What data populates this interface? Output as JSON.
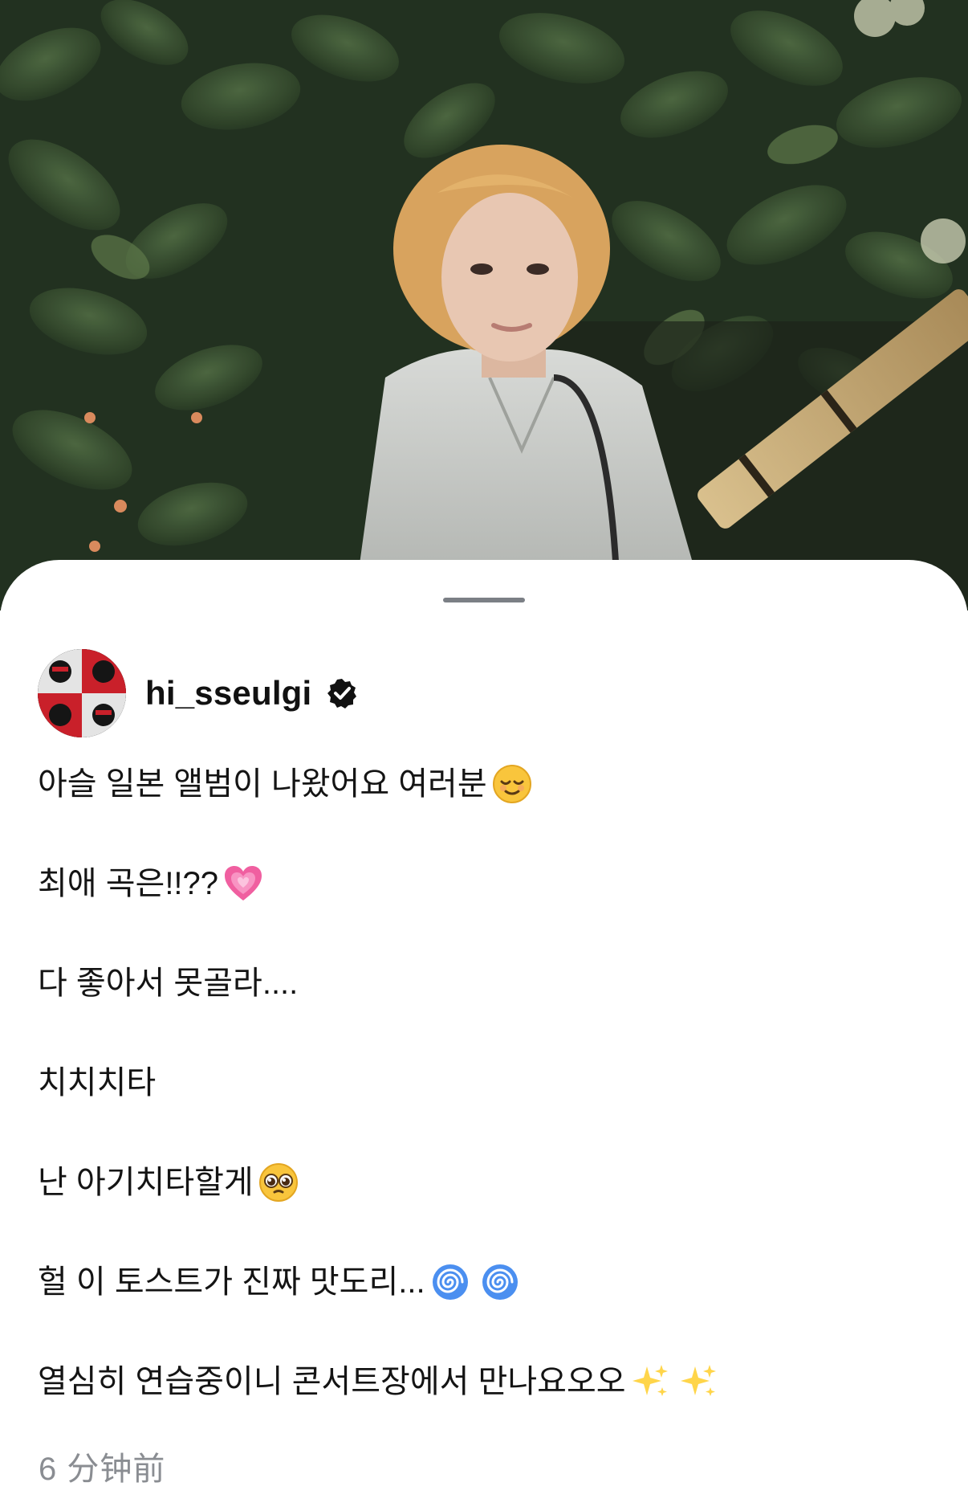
{
  "post": {
    "username": "hi_sseulgi",
    "verified": true,
    "caption_lines": [
      {
        "text": "아슬 일본 앨범이 나왔어요 여러분",
        "emoji": [
          "relieved-face"
        ]
      },
      {
        "text": "최애 곡은!!??",
        "emoji": [
          "growing-heart"
        ]
      },
      {
        "text": "다 좋아서 못골라....",
        "emoji": []
      },
      {
        "text": "치치치타",
        "emoji": []
      },
      {
        "text": "난 아기치타할게",
        "emoji": [
          "pleading-face"
        ]
      },
      {
        "text": "헐 이 토스트가 진짜 맛도리...",
        "emoji": [
          "cyclone",
          "cyclone"
        ]
      },
      {
        "text": "열심히 연습중이니 콘서트장에서 만나요오오",
        "emoji": [
          "sparkles",
          "sparkles"
        ]
      }
    ],
    "timestamp": "6 分钟前"
  },
  "colors": {
    "sheet_background": "#ffffff",
    "text_primary": "#141414",
    "text_secondary": "#8a8d92",
    "verified_badge": "#111111"
  }
}
